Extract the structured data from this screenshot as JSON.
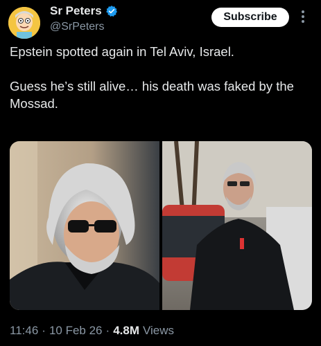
{
  "author": {
    "display_name": "Sr Peters",
    "handle": "@SrPeters",
    "avatar_icon": "cartoon-avatar-icon",
    "verified_icon": "verified-badge-icon",
    "verified_color": "#1d9bf0"
  },
  "actions": {
    "subscribe_label": "Subscribe",
    "more_icon": "more-vertical-icon"
  },
  "tweet": {
    "line1": "Epstein spotted again in Tel Aviv, Israel.",
    "line2": "Guess he’s still alive… his death was faked by the Mossad."
  },
  "media": [
    {
      "kind": "photo"
    },
    {
      "kind": "photo"
    }
  ],
  "meta": {
    "time": "11:46",
    "date": "10 Feb 26",
    "separator": "·",
    "views_count": "4.8M",
    "views_label": "Views"
  },
  "colors": {
    "background": "#000000",
    "text": "#e7e9ea",
    "secondary": "#8b98a5",
    "button_bg": "#ffffff"
  }
}
